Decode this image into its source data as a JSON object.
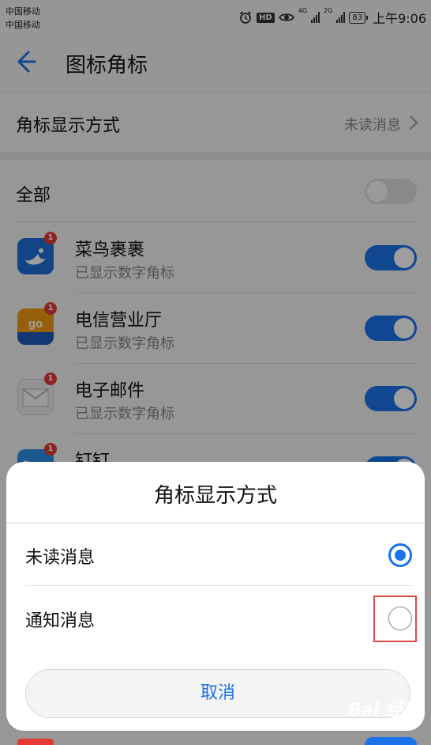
{
  "status": {
    "carrier1": "中国移动",
    "carrier2": "中国移动",
    "hd": "HD",
    "net1": "4G",
    "net2": "2G",
    "battery": "83",
    "time": "上午9:06"
  },
  "appbar": {
    "title": "图标角标"
  },
  "mode_row": {
    "label": "角标显示方式",
    "value": "未读消息"
  },
  "all": {
    "label": "全部",
    "toggle": "off"
  },
  "apps": [
    {
      "name": "菜鸟裹裹",
      "sub": "已显示数字角标",
      "badge": "1",
      "toggle": "on"
    },
    {
      "name": "电信营业厅",
      "sub": "已显示数字角标",
      "badge": "1",
      "toggle": "on"
    },
    {
      "name": "电子邮件",
      "sub": "已显示数字角标",
      "badge": "1",
      "toggle": "on"
    },
    {
      "name": "钉钉",
      "sub": "",
      "badge": "1",
      "toggle": "on"
    }
  ],
  "dialog": {
    "title": "角标显示方式",
    "options": [
      {
        "label": "未读消息",
        "selected": true
      },
      {
        "label": "通知消息",
        "selected": false
      }
    ],
    "cancel": "取消"
  },
  "watermark": "Bai 经验",
  "colors": {
    "accent": "#1a73e8",
    "badge": "#e53935",
    "highlight": "#e04848"
  }
}
